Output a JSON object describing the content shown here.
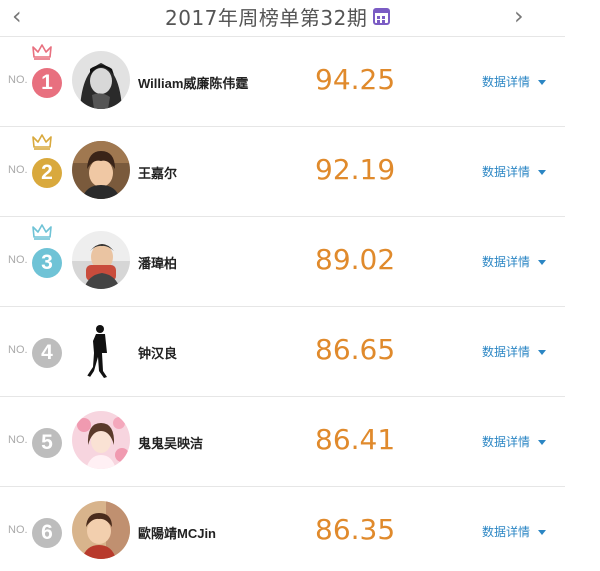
{
  "header": {
    "prev_glyph": "‹",
    "title": "2017年周榜单第32期",
    "next_glyph": "›",
    "calendar_icon": "calendar-icon",
    "calendar_color": "#7b5cc4"
  },
  "no_label": "NO.",
  "details_label": "数据详情",
  "colors": {
    "score": "#e08a2c",
    "link": "#2b86c4",
    "rank_default": "#bdbdbd"
  },
  "rows": [
    {
      "rank": "1",
      "name": "William威廉陈伟霆",
      "score": "94.25",
      "badge_color": "#e8707f",
      "crown_color": "#e8707f",
      "has_crown": true
    },
    {
      "rank": "2",
      "name": "王嘉尔",
      "score": "92.19",
      "badge_color": "#d9a93d",
      "crown_color": "#d9a93d",
      "has_crown": true
    },
    {
      "rank": "3",
      "name": "潘瑋柏",
      "score": "89.02",
      "badge_color": "#6fc3d6",
      "crown_color": "#6fc3d6",
      "has_crown": true
    },
    {
      "rank": "4",
      "name": "钟汉良",
      "score": "86.65",
      "badge_color": "#bdbdbd",
      "has_crown": false
    },
    {
      "rank": "5",
      "name": "鬼鬼吴映洁",
      "score": "86.41",
      "badge_color": "#bdbdbd",
      "has_crown": false
    },
    {
      "rank": "6",
      "name": "歐陽靖MCJin",
      "score": "86.35",
      "badge_color": "#bdbdbd",
      "has_crown": false
    }
  ]
}
